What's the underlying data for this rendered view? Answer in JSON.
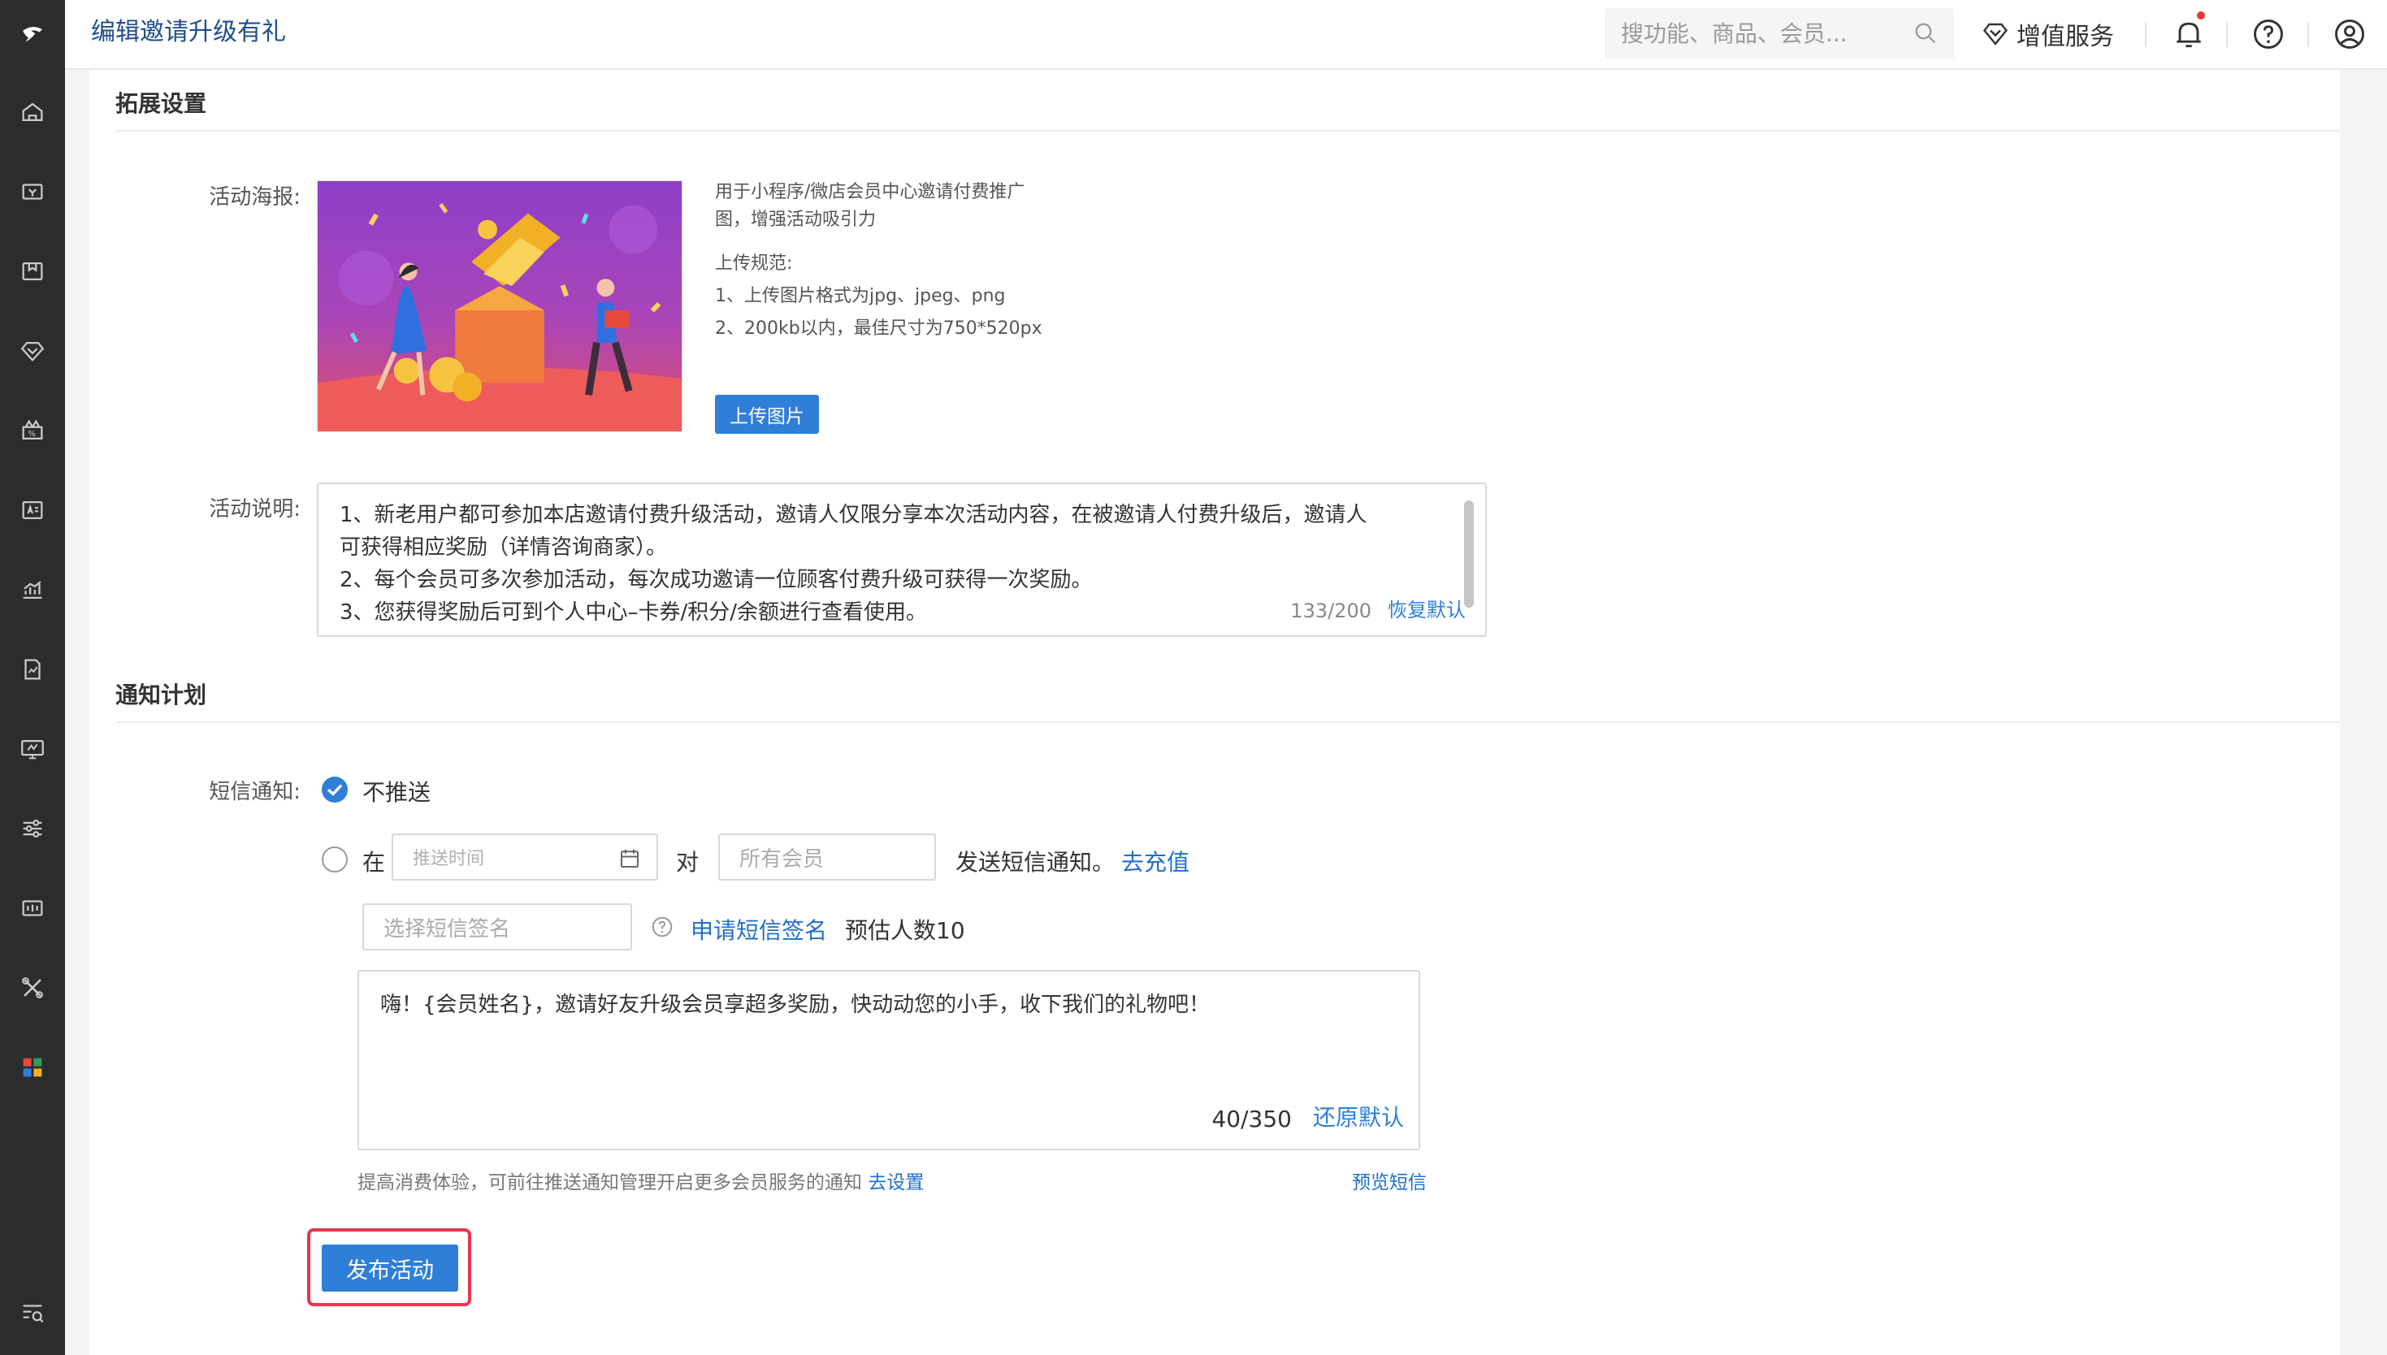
{
  "header": {
    "title": "编辑邀请升级有礼",
    "search_placeholder": "搜功能、商品、会员...",
    "value_added_label": "增值服务"
  },
  "sections": {
    "extend_title": "拓展设置",
    "notify_title": "通知计划"
  },
  "poster": {
    "label": "活动海报:",
    "hint_line1": "用于小程序/微店会员中心邀请付费推广",
    "hint_line2": "图，增强活动吸引力",
    "rules_title": "上传规范:",
    "rule1": "1、上传图片格式为jpg、jpeg、png",
    "rule2": "2、200kb以内，最佳尺寸为750*520px",
    "upload_label": "上传图片"
  },
  "description": {
    "label": "活动说明:",
    "lines": [
      "1、新老用户都可参加本店邀请付费升级活动，邀请人仅限分享本次活动内容，在被邀请人付费升级后，邀请人",
      "可获得相应奖励（详情咨询商家）。",
      "2、每个会员可多次参加活动，每次成功邀请一位顾客付费升级可获得一次奖励。",
      "3、您获得奖励后可到个人中心–卡券/积分/余额进行查看使用。"
    ],
    "count": "133/200",
    "reset_label": "恢复默认"
  },
  "sms": {
    "label": "短信通知:",
    "option_no_push": "不推送",
    "option_at": "在",
    "time_placeholder": "推送时间",
    "to_label": "对",
    "members_placeholder": "所有会员",
    "send_text": "发送短信通知。",
    "recharge_link": "去充值",
    "signature_placeholder": "选择短信签名",
    "apply_signature_link": "申请短信签名",
    "estimate": "预估人数10",
    "message": "嗨！{会员姓名}，邀请好友升级会员享超多奖励，快动动您的小手，收下我们的礼物吧！",
    "count": "40/350",
    "reset_label": "还原默认",
    "tip": "提高消费体验，可前往推送通知管理开启更多会员服务的通知",
    "tip_link": "去设置",
    "preview_link": "预览短信"
  },
  "actions": {
    "publish_label": "发布活动"
  },
  "colors": {
    "primary": "#2f7fd8",
    "link": "#1f6fcc",
    "sidebar": "#2b2c2e",
    "highlight": "#e8364d"
  }
}
